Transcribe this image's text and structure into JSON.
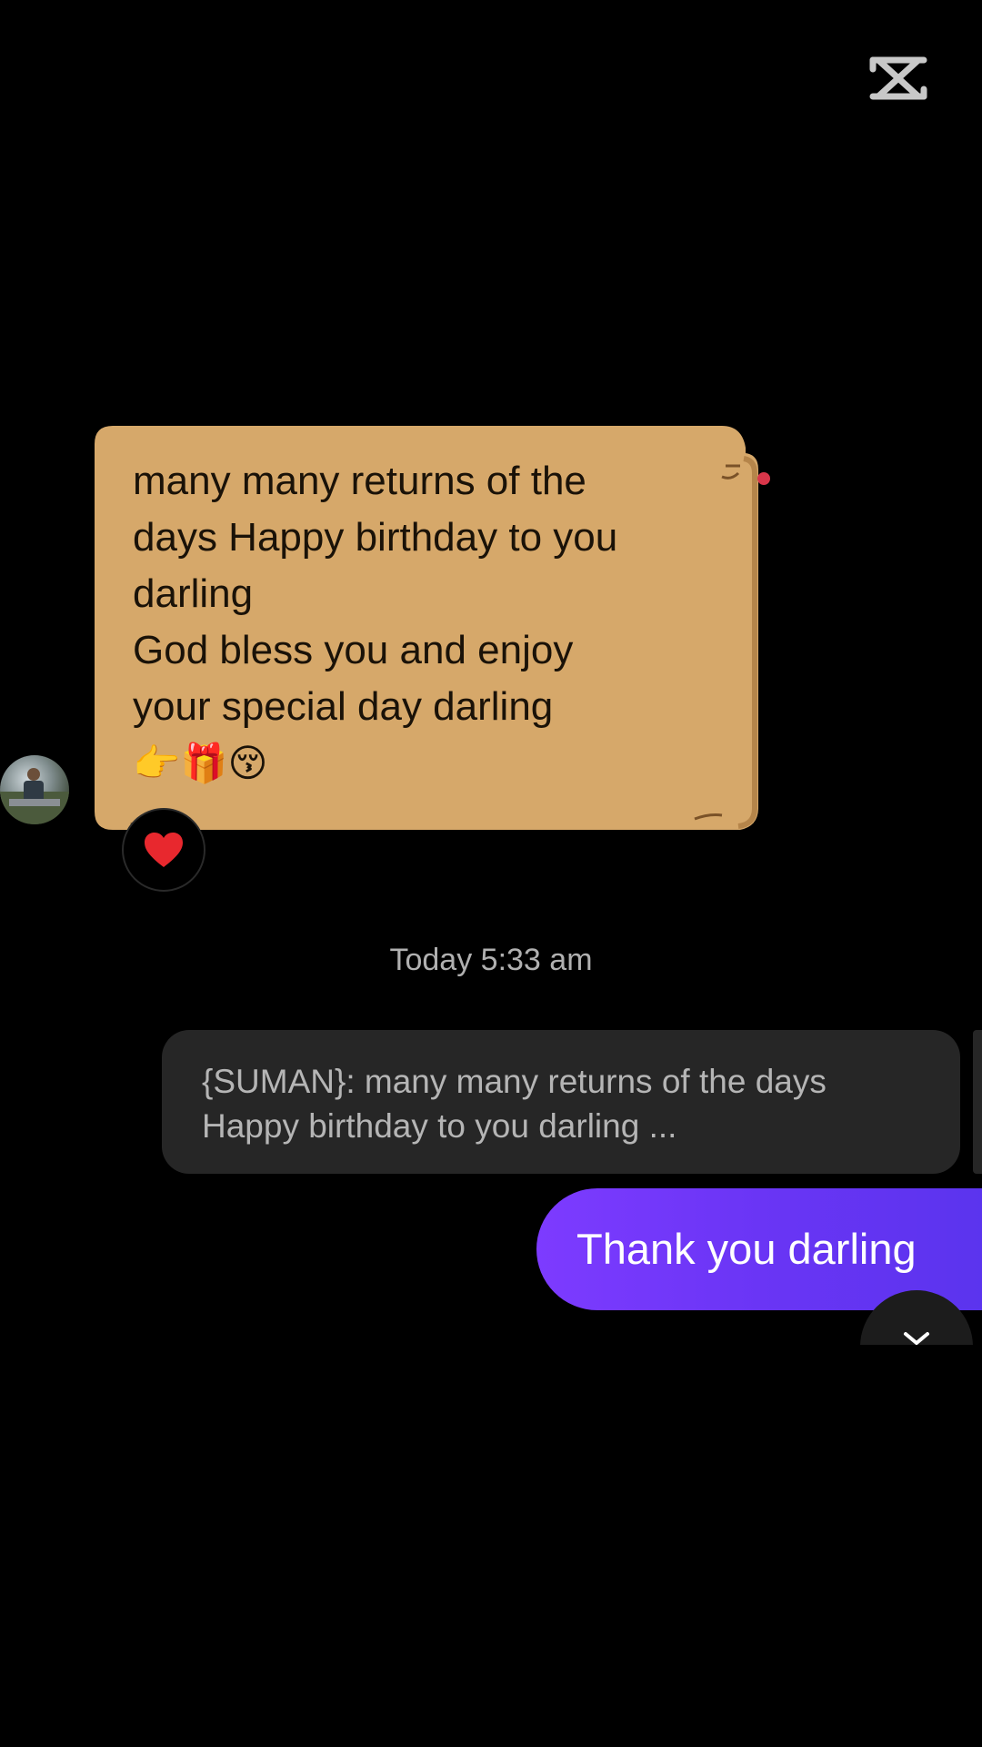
{
  "branding": {
    "logo_icon": "capcut-logo-icon"
  },
  "incoming_message": {
    "lines": [
      "many many returns of the",
      "days Happy birthday to you",
      "darling",
      "God bless you and enjoy",
      "your special day darling"
    ],
    "emojis": "👉🎁😚",
    "reaction": "❤️",
    "bubble_color": "#D6A86A"
  },
  "timestamp": "Today 5:33 am",
  "reply_preview": {
    "line1": "{SUMAN}: many many returns of the days",
    "line2": "Happy birthday to you darling ..."
  },
  "outgoing_message": {
    "text": "Thank you darling",
    "color": "#6E36F8"
  },
  "colors": {
    "background": "#000000",
    "reply_bg": "#262626",
    "timestamp": "#B0B0B0"
  }
}
